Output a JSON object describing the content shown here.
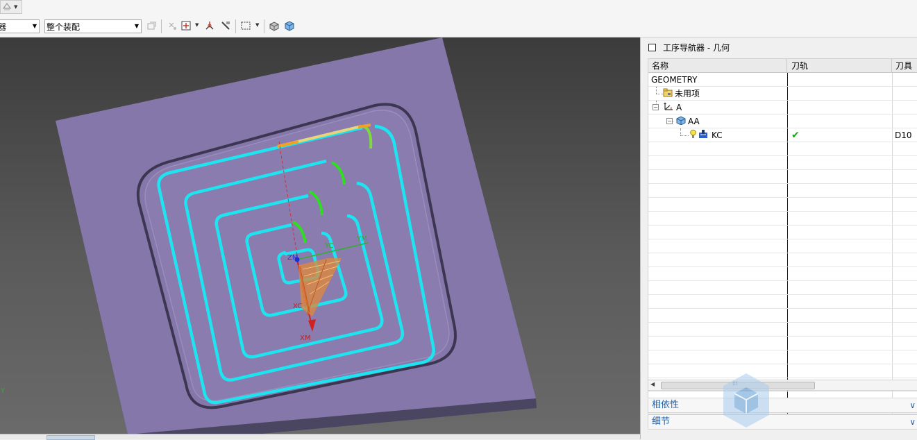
{
  "toolbar": {
    "filter_combo": "器",
    "scope_combo": "整个装配"
  },
  "viewport": {
    "labels": {
      "zm": "ZM",
      "yc": "YC",
      "ym": "YM",
      "xc": "XC",
      "xm": "XM",
      "y": "Y"
    },
    "colors": {
      "part": "#8577a9",
      "toolpath": "#1ee3f0",
      "engage": "#2fdf1f",
      "background": "#4a4a4a"
    }
  },
  "navigator": {
    "title": "工序导航器 - 几何",
    "columns": [
      "名称",
      "刀轨",
      "刀具"
    ],
    "rows": [
      {
        "name": "GEOMETRY",
        "path": "",
        "tool": ""
      },
      {
        "name": "未用项",
        "path": "",
        "tool": ""
      },
      {
        "name": "A",
        "path": "",
        "tool": ""
      },
      {
        "name": "AA",
        "path": "",
        "tool": ""
      },
      {
        "name": "KC",
        "path": "✔",
        "tool": "D10"
      }
    ],
    "panels": [
      "相依性",
      "细节"
    ]
  }
}
